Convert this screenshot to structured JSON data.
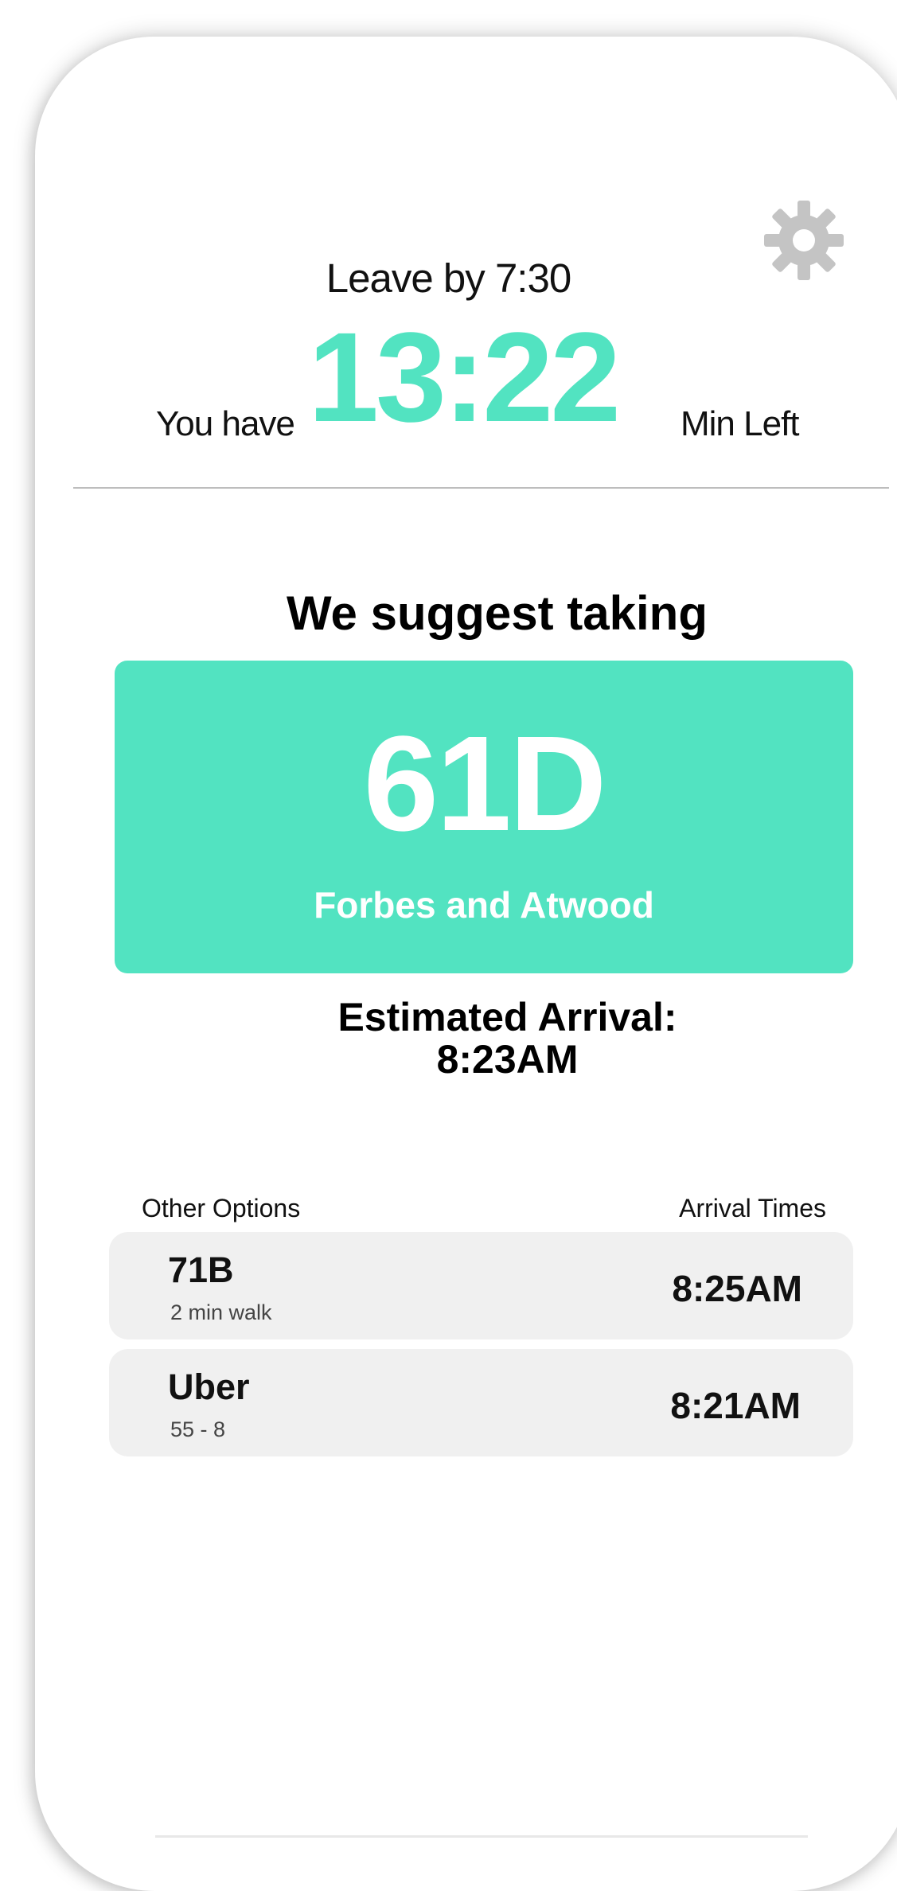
{
  "header": {
    "leave_by": "Leave by 7:30",
    "you_have": "You have",
    "countdown": "13:22",
    "min_left": "Min Left",
    "settings_icon": "gear-icon"
  },
  "suggestion": {
    "heading": "We suggest taking",
    "route": "61D",
    "stop": "Forbes and Atwood",
    "estimated_label": "Estimated Arrival:",
    "estimated_time": "8:23AM"
  },
  "options": {
    "header_left": "Other Options",
    "header_right": "Arrival Times",
    "items": [
      {
        "name": "71B",
        "detail": "2 min walk",
        "time": "8:25AM"
      },
      {
        "name": "Uber",
        "detail": "55 - 8",
        "time": "8:21AM"
      }
    ]
  },
  "colors": {
    "accent": "#52e3c1",
    "option_bg": "#f0f0f0",
    "gear": "#c4c4c4"
  }
}
